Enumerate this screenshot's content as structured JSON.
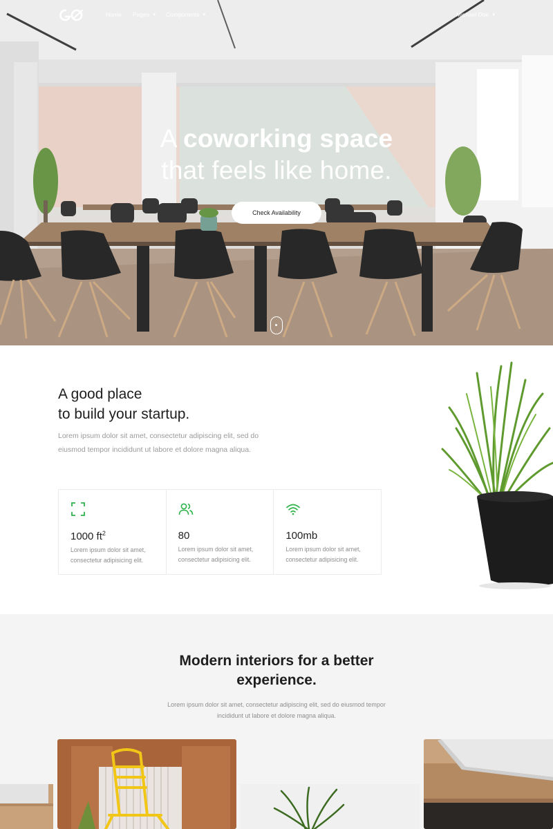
{
  "nav": {
    "logo_text": "GO",
    "home": "Home",
    "pages": "Pages",
    "components": "Components",
    "user": "Michael Doe"
  },
  "hero": {
    "title_part1": "A ",
    "title_bold": "coworking space",
    "title_line2": "that feels like home.",
    "cta_label": "Check Availability"
  },
  "about": {
    "title_line1": "A good place",
    "title_line2": "to build your startup.",
    "text": "Lorem ipsum dolor sit amet, consectetur adipiscing elit, sed do eiusmod tempor incididunt ut labore et dolore magna aliqua.",
    "features": [
      {
        "icon": "expand-icon",
        "value": "1000 ft",
        "sup": "2",
        "text": "Lorem ipsum dolor sit amet, consectetur adipisicing elit."
      },
      {
        "icon": "users-icon",
        "value": "80",
        "sup": "",
        "text": "Lorem ipsum dolor sit amet, consectetur adipisicing elit."
      },
      {
        "icon": "wifi-icon",
        "value": "100mb",
        "sup": "",
        "text": "Lorem ipsum dolor sit amet, consectetur adipisicing elit."
      }
    ]
  },
  "modern": {
    "title": "Modern interiors for a better experience.",
    "text": "Lorem ipsum dolor sit amet, consectetur adipiscing elit, sed do eiusmod tempor incididunt ut labore et dolore magna aliqua."
  },
  "colors": {
    "accent": "#2db34a",
    "section_bg": "#f4f4f4",
    "text_dark": "#1e1e1e",
    "text_muted": "#9a9a9a"
  }
}
